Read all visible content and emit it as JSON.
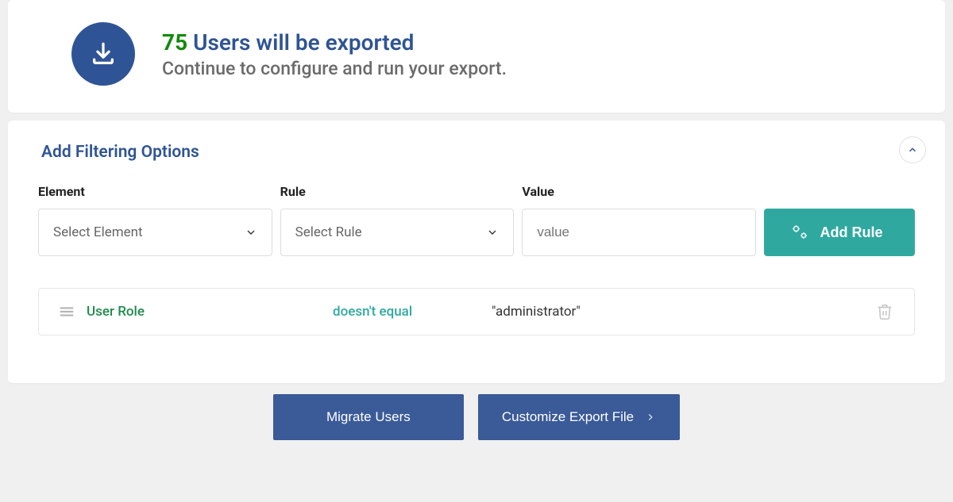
{
  "header": {
    "count": "75",
    "title_suffix": "Users will be exported",
    "subtitle": "Continue to configure and run your export."
  },
  "filter": {
    "section_title": "Add Filtering Options",
    "columns": {
      "element_label": "Element",
      "rule_label": "Rule",
      "value_label": "Value"
    },
    "element_select_placeholder": "Select Element",
    "rule_select_placeholder": "Select Rule",
    "value_input_placeholder": "value",
    "add_rule_label": "Add Rule",
    "rules": [
      {
        "element": "User Role",
        "operator": "doesn't equal",
        "value": "\"administrator\""
      }
    ]
  },
  "actions": {
    "migrate_label": "Migrate Users",
    "customize_label": "Customize Export File"
  }
}
